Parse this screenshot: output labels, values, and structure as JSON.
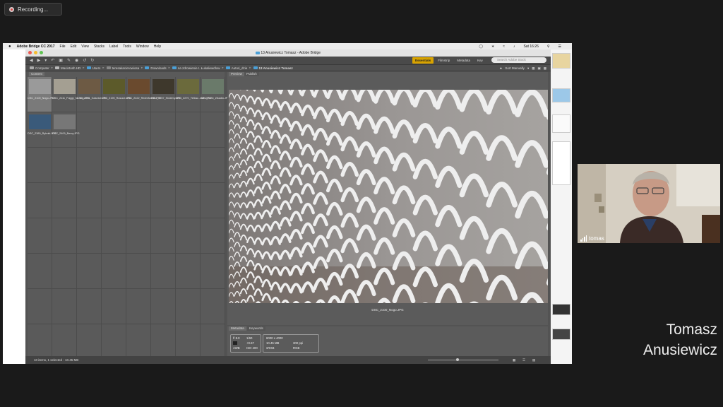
{
  "recording": {
    "label": "Recording..."
  },
  "mac_menu": {
    "app_name": "Adobe Bridge CC 2017",
    "items": [
      "File",
      "Edit",
      "View",
      "Stacks",
      "Label",
      "Tools",
      "Window",
      "Help"
    ],
    "clock": "Sat 16:26"
  },
  "bridge": {
    "window_title": "13 Anusiewicz Tomasz - Adobe Bridge",
    "workspaces": [
      "Essentials",
      "Filmstrip",
      "Metadata",
      "Key"
    ],
    "search_placeholder": "Search Adobe Stock",
    "breadcrumbs": [
      "Computer",
      "Macintosh HD",
      "Users",
      "teresakacierowiosa",
      "Downloads",
      "na zdrowienie I. Łukaliewdlow",
      "Autori_dzie",
      "13 Anusiewicz Tomasz"
    ],
    "sort_label": "Sort Manually",
    "content_tab": "Content",
    "preview_tabs": [
      "Preview",
      "Publish"
    ],
    "thumbnails": [
      {
        "label": "DSC_2100_Nogo.JPG",
        "selected": true,
        "color": "#9a9a9a"
      },
      {
        "label": "DSC_2111_Foggy_fo...ery.JPG",
        "selected": false,
        "color": "#a49f92"
      },
      {
        "label": "DSC_2161_Gasnice.JPG",
        "selected": false,
        "color": "#6d5a44"
      },
      {
        "label": "DSC_2190_Rusoce.JPG",
        "selected": false,
        "color": "#5c5a2a"
      },
      {
        "label": "DSC_2222_Redmforest.JPG",
        "selected": false,
        "color": "#6a4a2e"
      },
      {
        "label": "DSC_2257_Kbdemy.JPG",
        "selected": false,
        "color": "#3e382c"
      },
      {
        "label": "DSC_2270_Yellow...own.JPG",
        "selected": false,
        "color": "#6b6a3c"
      },
      {
        "label": "DSC_2284_Zikadio.JPG",
        "selected": false,
        "color": "#6a7a6a"
      },
      {
        "label": "DSC_2380_Rybnik.JPG",
        "selected": false,
        "color": "#3a5a7a"
      },
      {
        "label": "DSC_2409_Bercy.JPG",
        "selected": false,
        "color": "#777777"
      }
    ],
    "preview_caption": "DSC_2100_Nogo.JPG",
    "metadata_tabs": [
      "Metadata",
      "Keywords"
    ],
    "metadata": {
      "aperture": "f/ 8.0",
      "shutter": "1/60",
      "ev": "+0.67",
      "iso": "ISO 400",
      "dimensions": "6000 x 4000",
      "filesize": "10.45 MB",
      "ppi": "300 ppi",
      "colorspace": "sRGB",
      "mode": "RGB"
    },
    "status": "10 items, 1 selected - 10.45 MB"
  },
  "participant": {
    "name": "tomas"
  },
  "speaker_name": {
    "line1": "Tomasz",
    "line2": "Anusiewicz"
  },
  "colors": {
    "accent": "#d8a300",
    "folder": "#4aa0d8",
    "record": "#e04040"
  }
}
